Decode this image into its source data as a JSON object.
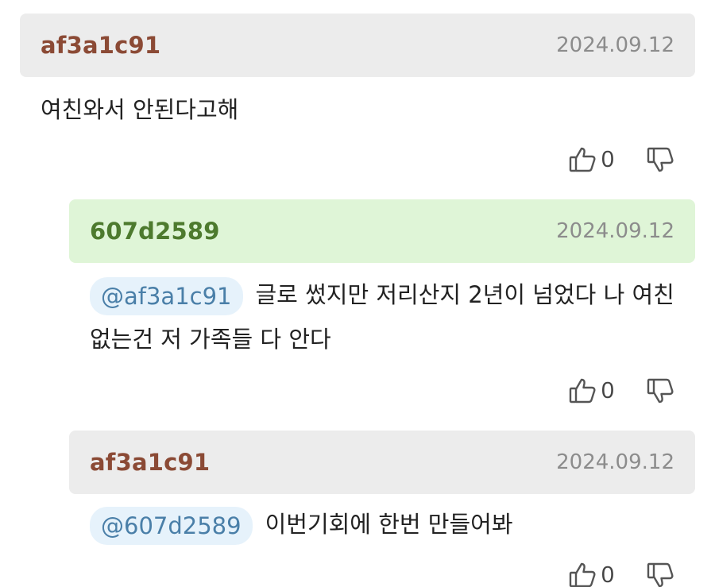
{
  "comments": [
    {
      "author": "af3a1c91",
      "date": "2024.09.12",
      "text": "여친와서 안된다고해",
      "likes": "0"
    },
    {
      "author": "607d2589",
      "date": "2024.09.12",
      "mention": "@af3a1c91",
      "text": "글로 썼지만 저리산지 2년이 넘었다 나 여친 없는건 저 가족들 다 안다",
      "likes": "0"
    },
    {
      "author": "af3a1c91",
      "date": "2024.09.12",
      "mention": "@607d2589",
      "text": "이번기회에 한번 만들어봐",
      "likes": "0"
    }
  ],
  "icons": {
    "like": "thumbs-up-icon",
    "dislike": "thumbs-down-icon"
  },
  "colors": {
    "author_original": "#8b4a35",
    "author_reply": "#4d7a2e",
    "header_gray": "#ececec",
    "header_green": "#dff5d7",
    "mention_bg": "#e6f2fb",
    "mention_text": "#4a7fa8"
  }
}
